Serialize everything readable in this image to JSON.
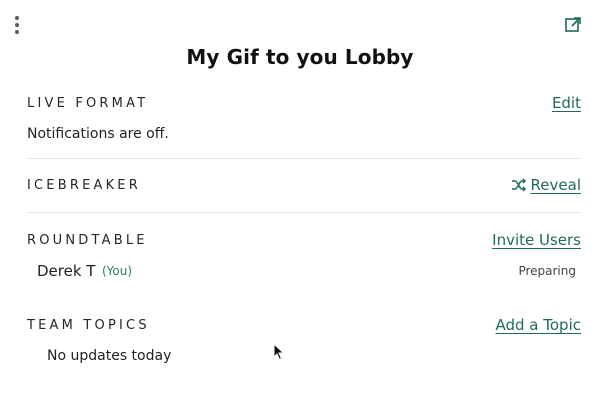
{
  "header": {
    "title": "My Gif to you Lobby",
    "menu_icon": "kebab-menu-icon",
    "popout_icon": "external-link-icon"
  },
  "sections": {
    "live_format": {
      "label": "LIVE FORMAT",
      "action": "Edit",
      "note": "Notifications are off."
    },
    "icebreaker": {
      "label": "ICEBREAKER",
      "action": "Reveal",
      "action_icon": "shuffle-icon"
    },
    "roundtable": {
      "label": "ROUNDTABLE",
      "action": "Invite Users",
      "members": [
        {
          "name": "Derek T",
          "tag": "(You)",
          "status": "Preparing"
        }
      ]
    },
    "team_topics": {
      "label": "TEAM TOPICS",
      "action": "Add a Topic",
      "empty_text": "No updates today"
    }
  },
  "colors": {
    "accent": "#1f6a58",
    "you_tag": "#2c7a64",
    "divider": "#e6e6e6",
    "text": "#1f1f1f"
  }
}
